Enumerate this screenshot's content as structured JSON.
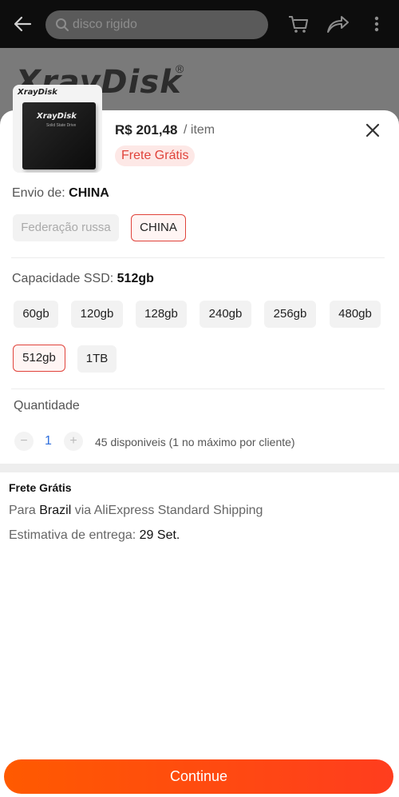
{
  "header": {
    "search_placeholder": "disco rigido"
  },
  "background": {
    "brand": "XrayDisk",
    "reg_mark": "®"
  },
  "product": {
    "thumb_brand": "XrayDisk",
    "thumb_label": "XrayDisk",
    "thumb_sub": "Solid State Drive",
    "price": "R$ 201,48",
    "unit": "/ item",
    "badge": "Frete Grátis"
  },
  "ship_from": {
    "label": "Envio de:",
    "value": "CHINA",
    "options": [
      "Federação russa",
      "CHINA"
    ],
    "selected": "CHINA"
  },
  "capacity": {
    "label": "Capacidade SSD:",
    "value": "512gb",
    "options": [
      "60gb",
      "120gb",
      "128gb",
      "240gb",
      "256gb",
      "480gb",
      "512gb",
      "1TB"
    ],
    "selected": "512gb"
  },
  "quantity": {
    "label": "Quantidade",
    "minus": "−",
    "value": "1",
    "plus": "+",
    "stock": "45 disponiveis (1 no máximo por cliente)"
  },
  "shipping": {
    "title": "Frete Grátis",
    "line1_prefix": "Para",
    "line1_country": "Brazil",
    "line1_suffix": "via AliExpress Standard Shipping",
    "line2_prefix": "Estimativa de entrega:",
    "line2_date": "29 Set."
  },
  "cta": {
    "label": "Continue"
  },
  "colors": {
    "accent": "#e0433b",
    "cta_start": "#ff5a00",
    "cta_end": "#ff3d1e"
  }
}
